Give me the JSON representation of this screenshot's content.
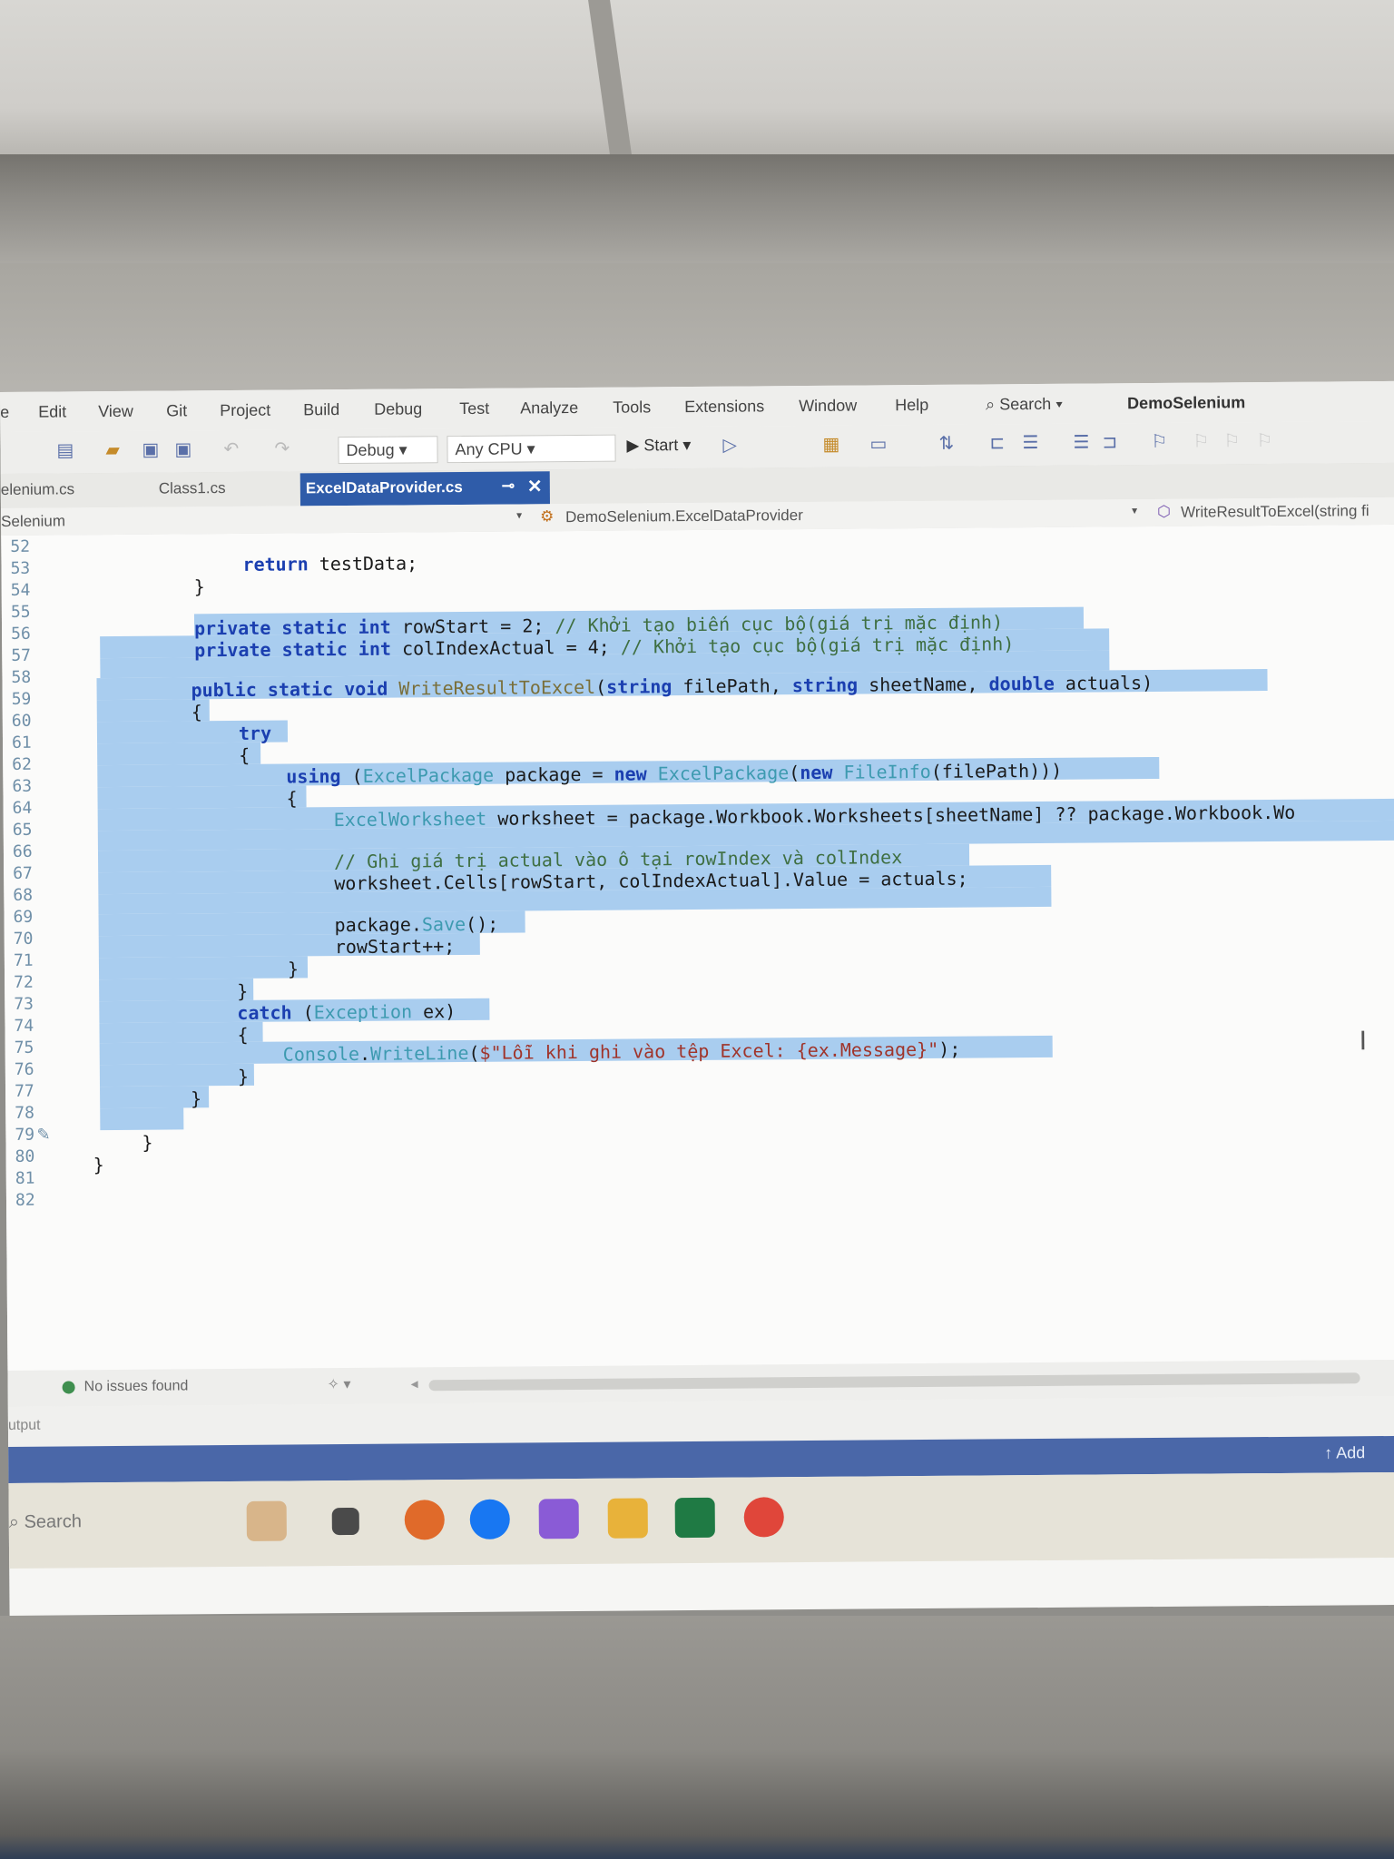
{
  "menu": [
    "e",
    "Edit",
    "View",
    "Git",
    "Project",
    "Build",
    "Debug",
    "Test",
    "Analyze",
    "Tools",
    "Extensions",
    "Window",
    "Help"
  ],
  "search": {
    "label": "Search"
  },
  "solution_name": "DemoSelenium",
  "toolbar": {
    "config": "Debug",
    "platform": "Any CPU",
    "start": "Start"
  },
  "tabs": {
    "t1": "elenium.cs",
    "t2": "Class1.cs",
    "active": "ExcelDataProvider.cs"
  },
  "nav": {
    "project": "Selenium",
    "class": "DemoSelenium.ExcelDataProvider",
    "member": "WriteResultToExcel(string fi"
  },
  "line_numbers": [
    "52",
    "53",
    "54",
    "55",
    "56",
    "57",
    "58",
    "59",
    "60",
    "61",
    "62",
    "63",
    "64",
    "65",
    "66",
    "67",
    "68",
    "69",
    "70",
    "71",
    "72",
    "73",
    "74",
    "75",
    "76",
    "77",
    "78",
    "79",
    "80",
    "81",
    "82"
  ],
  "code": {
    "l53_kw": "return",
    "l53_rest": " testData;",
    "brace": "}",
    "open": "{",
    "l56_kw": "private static int",
    "l56_rest": " rowStart = 2; ",
    "l56_cm": "// Khởi tạo biến cục bộ(giá trị mặc định)",
    "l57_kw": "private static int",
    "l57_rest": " colIndexActual = 4; ",
    "l57_cm": "// Khởi tạo cục bộ(giá trị mặc định)",
    "l59_kw": "public static void",
    "l59_fn": " WriteResultToExcel",
    "l59_a": "(",
    "l59_k1": "string",
    "l59_b": " filePath, ",
    "l59_k2": "string",
    "l59_c": " sheetName, ",
    "l59_k3": "double",
    "l59_d": " actuals)",
    "try": "try",
    "l63_kw": "using",
    "l63_a": " (",
    "l63_t1": "ExcelPackage",
    "l63_b": " package = ",
    "l63_new": "new",
    "l63_t2": " ExcelPackage",
    "l63_c": "(",
    "l63_new2": "new",
    "l63_t3": " FileInfo",
    "l63_d": "(filePath)))",
    "l65_t": "ExcelWorksheet",
    "l65_rest": " worksheet = package.Workbook.Worksheets[sheetName] ?? package.Workbook.Wo",
    "l67_cm": "// Ghi giá trị actual vào ô tại rowIndex và colIndex",
    "l68": "worksheet.Cells[rowStart, colIndexActual].Value = actuals;",
    "l70_a": "package.",
    "l70_fn": "Save",
    "l70_b": "();",
    "l71": "rowStart++;",
    "l74_kw": "catch",
    "l74_a": " (",
    "l74_t": "Exception",
    "l74_b": " ex)",
    "l76_t": "Console",
    "l76_a": ".",
    "l76_fn": "WriteLine",
    "l76_b": "(",
    "l76_st": "$\"Lỗi khi ghi vào tệp Excel: {ex.Message}\"",
    "l76_c": ");"
  },
  "status": {
    "issues": "No issues found"
  },
  "output_label": "utput",
  "bluebar": {
    "add": "Add"
  },
  "taskbar": {
    "search": "Search"
  },
  "colors": {
    "selection": "#a9cdef",
    "keyword": "#1b3fb0",
    "type": "#3d9ab0",
    "comment": "#3f6f42",
    "tab_active": "#2f5ca9",
    "statusbar": "#4a67a8"
  }
}
